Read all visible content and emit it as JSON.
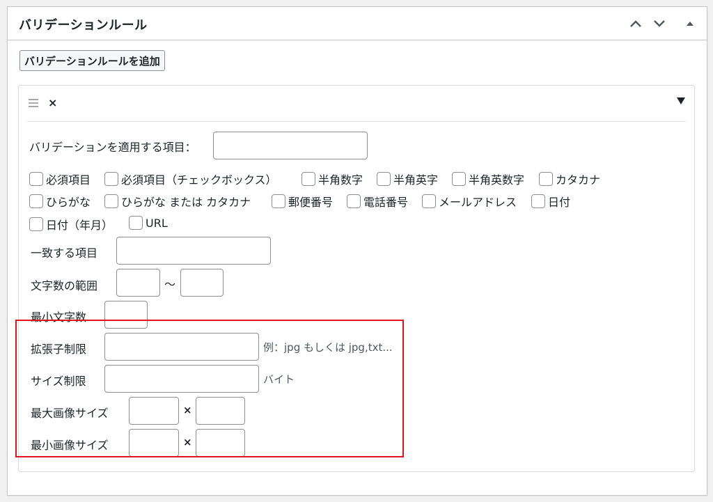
{
  "postbox": {
    "title": "バリデーションルール",
    "move_up_icon": "chevron-up-icon",
    "move_down_icon": "chevron-down-icon",
    "collapse_icon": "triangle-up-icon"
  },
  "add_button_label": "バリデーションルールを追加",
  "rule": {
    "remove_label": "×",
    "drag_icon": "drag-handle-icon",
    "toggle_icon": "triangle-down-icon",
    "target_label": "バリデーションを適用する項目：",
    "target_value": "",
    "checkboxes": [
      {
        "label": "必須項目",
        "checked": false
      },
      {
        "label": "必須項目（チェックボックス）",
        "checked": false
      },
      {
        "label": "半角数字",
        "checked": false
      },
      {
        "label": "半角英字",
        "checked": false
      },
      {
        "label": "半角英数字",
        "checked": false
      },
      {
        "label": "カタカナ",
        "checked": false
      },
      {
        "label": "ひらがな",
        "checked": false
      },
      {
        "label": "ひらがな または カタカナ",
        "checked": false
      },
      {
        "label": "郵便番号",
        "checked": false
      },
      {
        "label": "電話番号",
        "checked": false
      },
      {
        "label": "メールアドレス",
        "checked": false
      },
      {
        "label": "日付",
        "checked": false
      },
      {
        "label": "日付（年月）",
        "checked": false
      },
      {
        "label": "URL",
        "checked": false
      }
    ],
    "match_label": "一致する項目",
    "match_value": "",
    "length_range_label": "文字数の範囲",
    "length_min_value": "",
    "length_max_value": "",
    "range_separator": "〜",
    "min_length_label": "最小文字数",
    "min_length_value": "",
    "ext_label": "拡張子制限",
    "ext_value": "",
    "ext_hint": "例：jpg もしくは jpg,txt...",
    "size_label": "サイズ制限",
    "size_value": "",
    "size_unit": "バイト",
    "max_image_label": "最大画像サイズ",
    "max_image_width": "",
    "max_image_height": "",
    "min_image_label": "最小画像サイズ",
    "min_image_width": "",
    "min_image_height": "",
    "dim_separator": "×"
  },
  "colors": {
    "highlight": "#e0141e",
    "border": "#c3c4c7",
    "input_border": "#8c8f94"
  }
}
